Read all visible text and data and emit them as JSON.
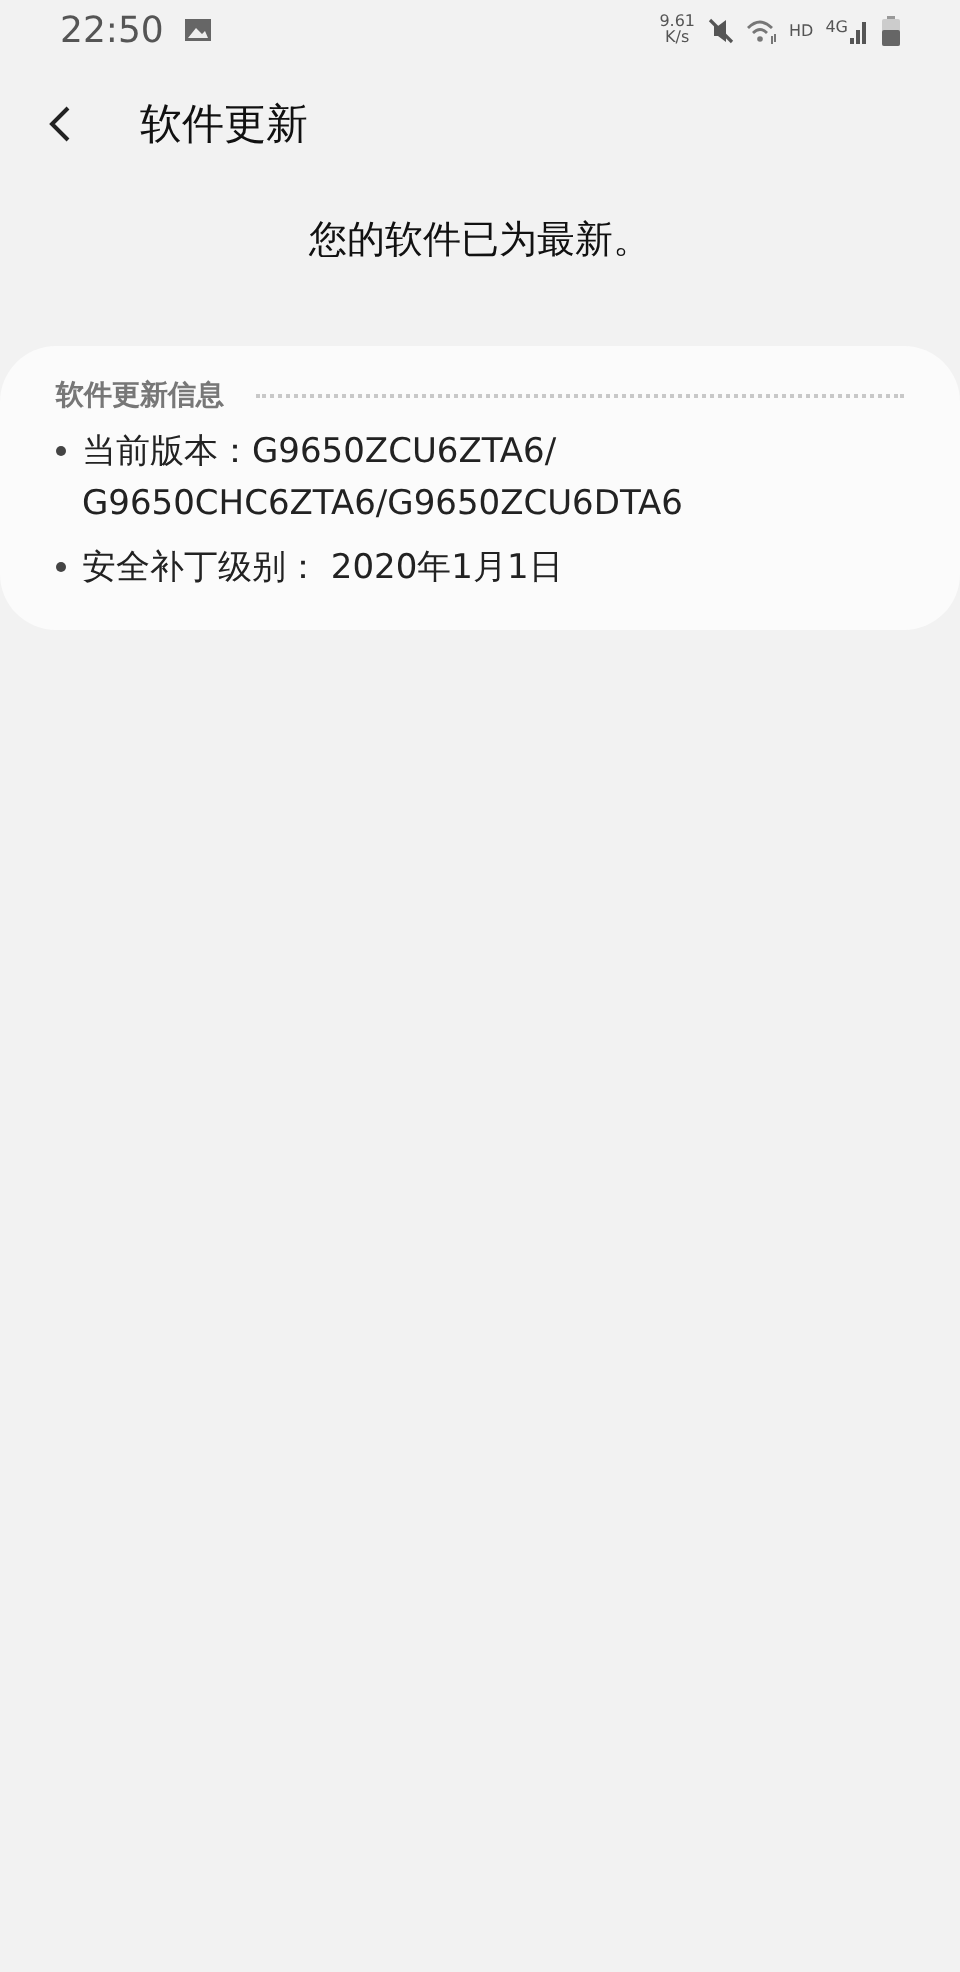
{
  "status_bar": {
    "time": "22:50",
    "net_speed": [
      "9.61",
      "K/s"
    ],
    "hd": "HD",
    "network": "4G"
  },
  "header": {
    "title": "软件更新"
  },
  "message": "您的软件已为最新。",
  "info_card": {
    "title": "软件更新信息",
    "items": [
      {
        "lines": [
          "当前版本：G9650ZCU6ZTA6/",
          "G9650CHC6ZTA6/G9650ZCU6DTA6"
        ]
      },
      {
        "lines": [
          "安全补丁级别： 2020年1月1日"
        ]
      }
    ]
  }
}
